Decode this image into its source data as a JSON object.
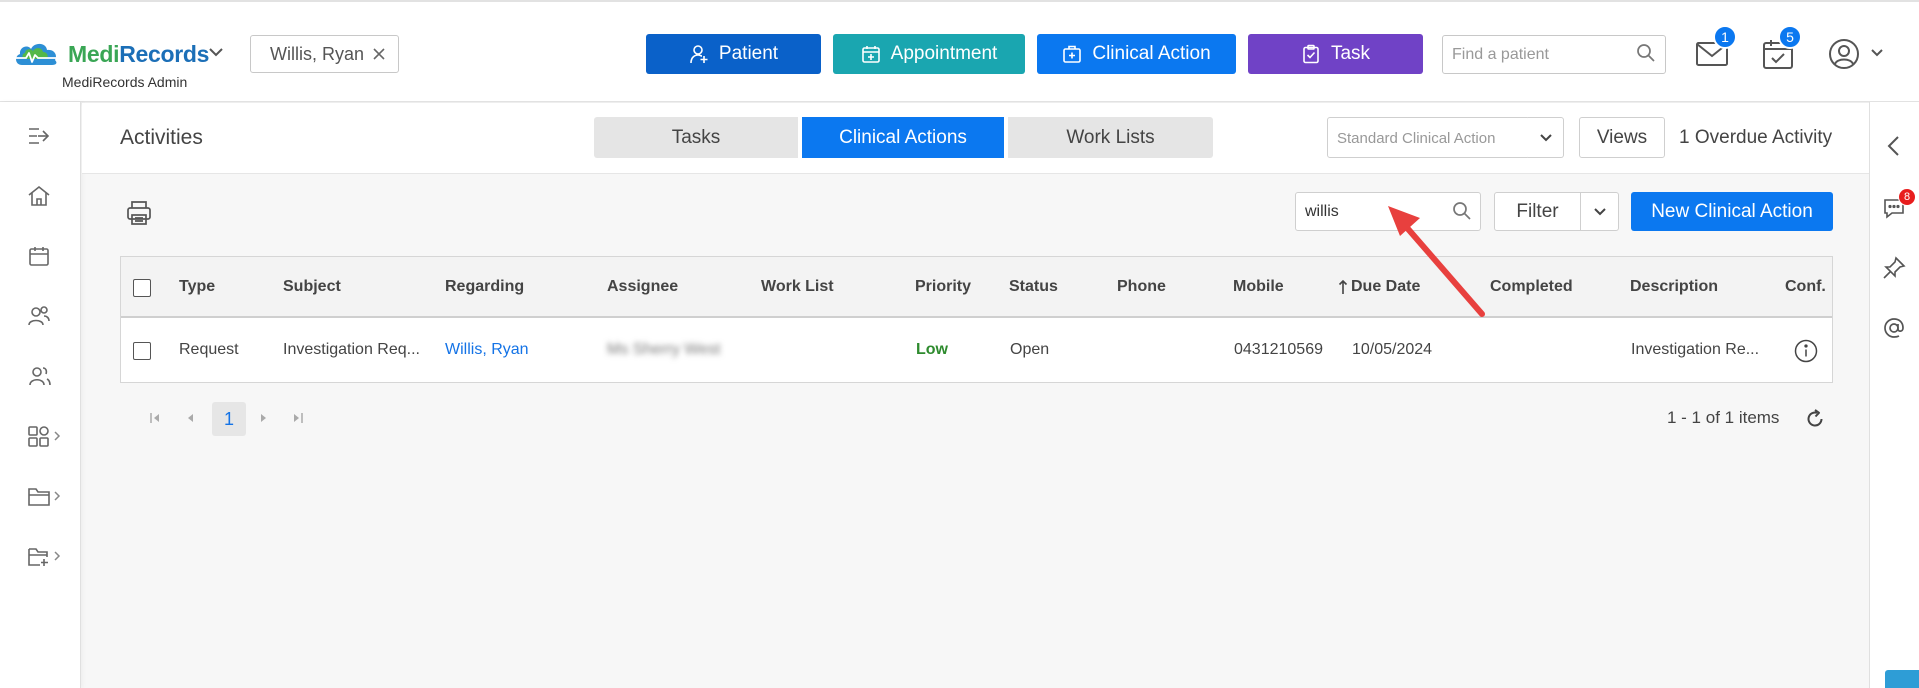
{
  "header": {
    "logo_medi": "Medi",
    "logo_records": "Records",
    "logo_subtitle": "MediRecords Admin",
    "patient_chip": "Willis, Ryan",
    "quick_actions": {
      "patient": "Patient",
      "appointment": "Appointment",
      "clinical_action": "Clinical Action",
      "task": "Task"
    },
    "find_patient_placeholder": "Find a patient",
    "mail_badge": "1",
    "calendar_badge": "5"
  },
  "content": {
    "title": "Activities",
    "segments": {
      "tasks": "Tasks",
      "clinical_actions": "Clinical Actions",
      "work_lists": "Work Lists"
    },
    "view_select": "Standard Clinical Action",
    "views_label": "Views",
    "overdue_label": "1 Overdue Activity",
    "search_value": "willis",
    "filter_label": "Filter",
    "new_button": "New Clinical Action"
  },
  "table": {
    "columns": [
      "Type",
      "Subject",
      "Regarding",
      "Assignee",
      "Work List",
      "Priority",
      "Status",
      "Phone",
      "Mobile",
      "Due Date",
      "Completed",
      "Description",
      "Conf."
    ],
    "sort_column": "Due Date",
    "rows": [
      {
        "type": "Request",
        "subject": "Investigation Req...",
        "regarding": "Willis, Ryan",
        "assignee": "Ms Sherry West",
        "work_list": "",
        "priority": "Low",
        "status": "Open",
        "phone": "",
        "mobile": "0431210569",
        "due_date": "10/05/2024",
        "completed": "",
        "description": "Investigation Re..."
      }
    ]
  },
  "pager": {
    "current_page": "1",
    "summary": "1 - 1 of 1 items"
  },
  "right_rail": {
    "chat_badge": "8"
  },
  "colors": {
    "primary_blue": "#0b78f0",
    "patient_blue": "#0a61c9",
    "appointment_teal": "#1aa6b0",
    "task_purple": "#7042c6",
    "priority_low": "#2e8b2e",
    "annotation_red": "#e8403e"
  }
}
